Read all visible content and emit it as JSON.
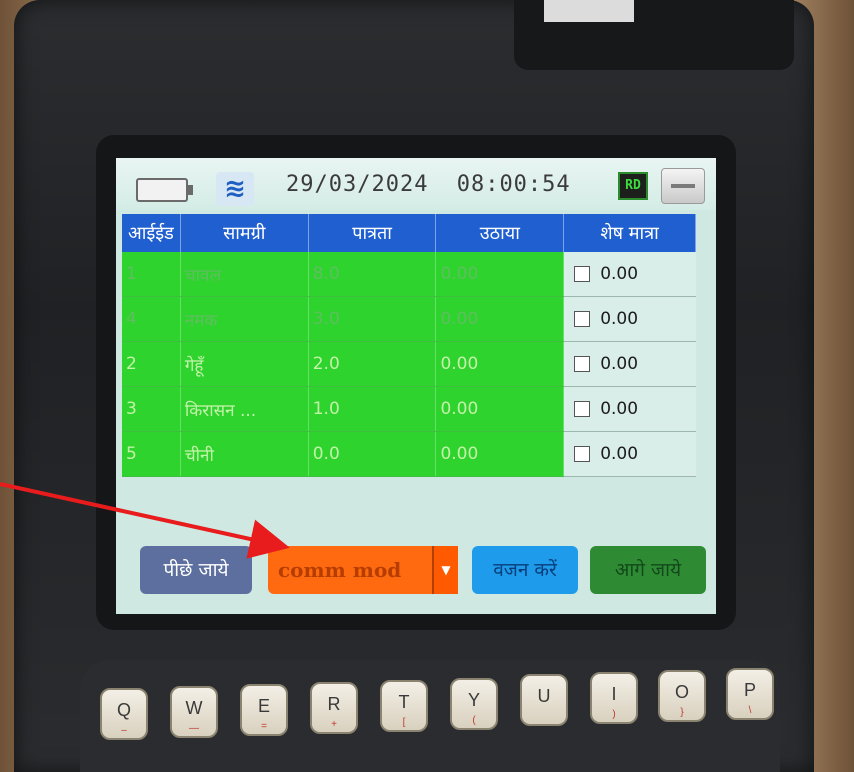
{
  "status_bar": {
    "date": "29/03/2024",
    "time": "08:00:54",
    "rd_badge": "RD",
    "icons": [
      "battery-icon",
      "wifi-icon"
    ]
  },
  "table": {
    "columns": [
      "आईईड",
      "सामग्री",
      "पात्रता",
      "उठाया",
      "शेष मात्रा"
    ],
    "rows": [
      {
        "id": "1",
        "item": "चावल",
        "eligibility": "8.0",
        "lifted": "0.00",
        "remaining": "0.00"
      },
      {
        "id": "4",
        "item": "नमक",
        "eligibility": "3.0",
        "lifted": "0.00",
        "remaining": "0.00"
      },
      {
        "id": "2",
        "item": "गेहूँ",
        "eligibility": "2.0",
        "lifted": "0.00",
        "remaining": "0.00"
      },
      {
        "id": "3",
        "item": "किरासन ...",
        "eligibility": "1.0",
        "lifted": "0.00",
        "remaining": "0.00"
      },
      {
        "id": "5",
        "item": "चीनी",
        "eligibility": "0.0",
        "lifted": "0.00",
        "remaining": "0.00"
      }
    ]
  },
  "buttons": {
    "back": "पीछे जाये",
    "comm_mode": "comm mod",
    "weigh": "वजन करें",
    "next": "आगे जाये"
  },
  "keyboard": {
    "keys": [
      {
        "label": "Q",
        "sub": "–"
      },
      {
        "label": "W",
        "sub": "—"
      },
      {
        "label": "E",
        "sub": "="
      },
      {
        "label": "R",
        "sub": "+"
      },
      {
        "label": "T",
        "sub": "["
      },
      {
        "label": "Y",
        "sub": "("
      },
      {
        "label": "U",
        "sub": ""
      },
      {
        "label": "I",
        "sub": ")"
      },
      {
        "label": "O",
        "sub": "}"
      },
      {
        "label": "P",
        "sub": "\\"
      }
    ]
  },
  "colors": {
    "header_blue": "#1f5fd0",
    "row_green": "#2ed32e",
    "comm_orange": "#ff6a10",
    "weigh_blue": "#1e9bea",
    "next_green": "#2e8b34",
    "annotation_arrow": "#e81c1c"
  }
}
